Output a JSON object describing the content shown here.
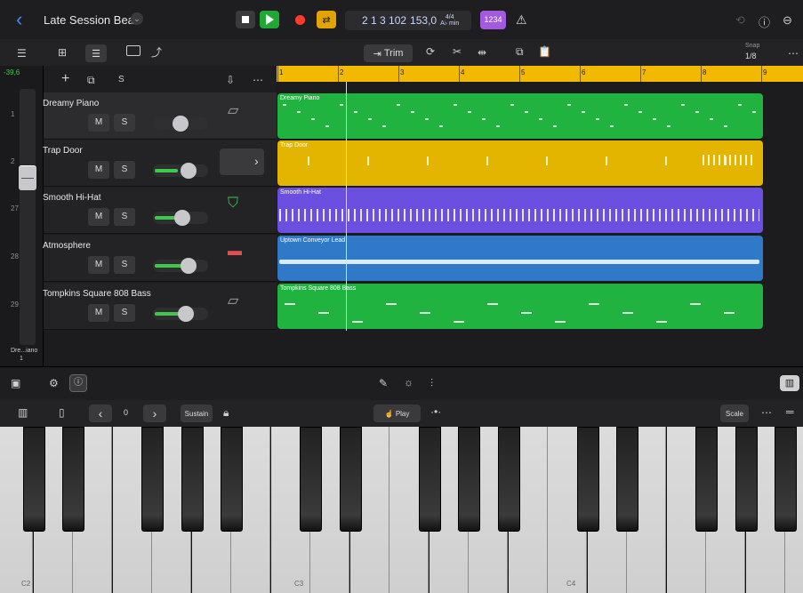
{
  "project": {
    "title": "Late Session Beat"
  },
  "transport": {
    "position": "2 1 3 102",
    "tempo": "153,0",
    "sig_top": "4/4",
    "sig_bottom": "A♭ min",
    "count_in": "1234"
  },
  "edit": {
    "trim_label": "Trim",
    "snap_label": "Snap",
    "snap_value": "1/8"
  },
  "strip": {
    "db": "-39,6",
    "name": "Dre...iano",
    "num": "1"
  },
  "ruler": {
    "bars": [
      "1",
      "2",
      "3",
      "4",
      "5",
      "6",
      "7",
      "8",
      "9"
    ]
  },
  "tracks": [
    {
      "num": "1",
      "name": "Dreamy Piano",
      "region": "Dreamy Piano",
      "color": "#21b33f"
    },
    {
      "num": "2",
      "name": "Trap Door",
      "region": "Trap Door",
      "color": "#e3b500"
    },
    {
      "num": "27",
      "name": "Smooth Hi-Hat",
      "region": "Smooth Hi-Hat",
      "color": "#6a4fe0"
    },
    {
      "num": "28",
      "name": "Atmosphere",
      "region": "Uptown Conveyor Lead",
      "color": "#2f79c8"
    },
    {
      "num": "29",
      "name": "Tompkins Square 808 Bass",
      "region": "Tompkins Square 808 Bass",
      "color": "#21b33f"
    }
  ],
  "ms": {
    "mute": "M",
    "solo": "S"
  },
  "keyboard": {
    "octave": "0",
    "sustain": "Sustain",
    "play": "Play",
    "scale": "Scale",
    "labels": [
      "C2",
      "C3",
      "C4"
    ]
  }
}
